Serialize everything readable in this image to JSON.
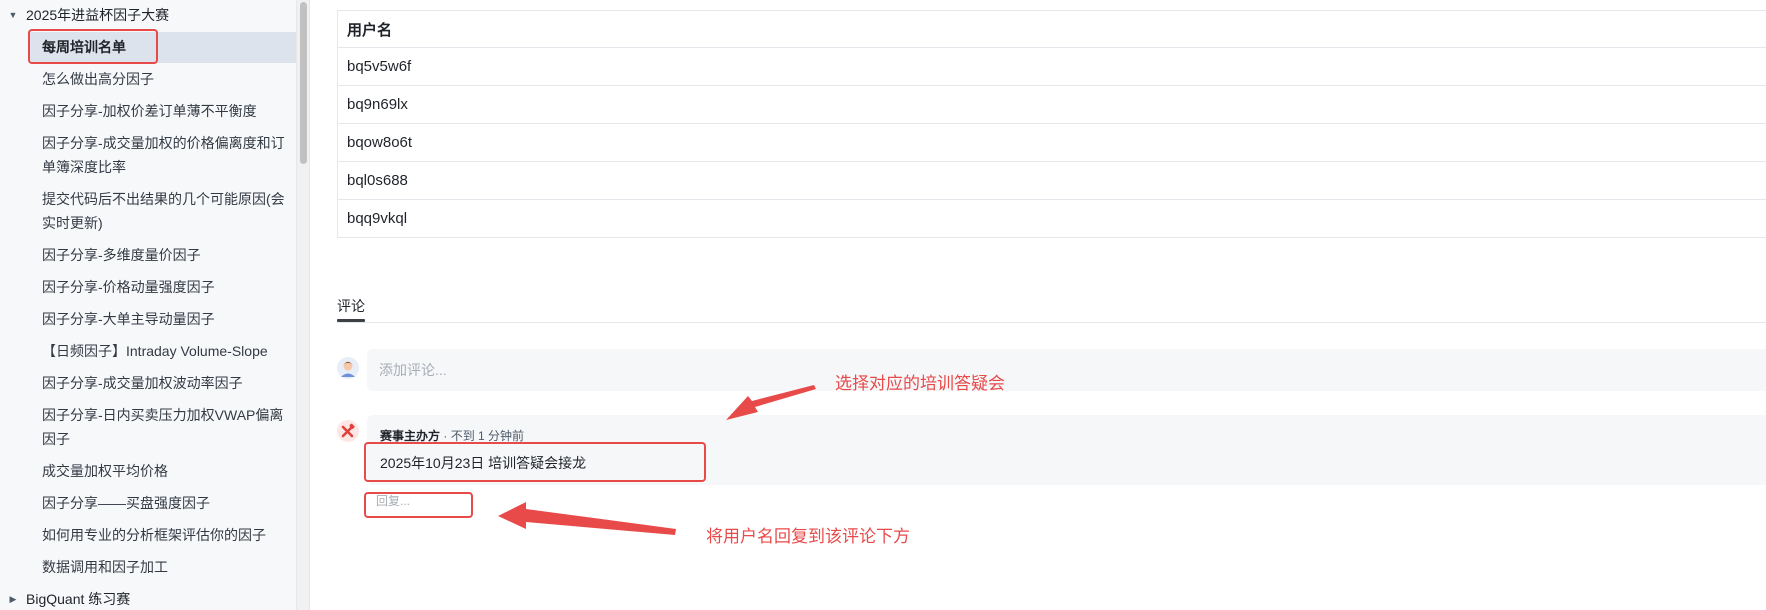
{
  "sidebar": {
    "group_open": "2025年进益杯因子大赛",
    "active_item": "每周培训名单",
    "items": [
      "怎么做出高分因子",
      "因子分享-加权价差订单薄不平衡度",
      "因子分享-成交量加权的价格偏离度和订单簿深度比率",
      "提交代码后不出结果的几个可能原因(会实时更新)",
      "因子分享-多维度量价因子",
      "因子分享-价格动量强度因子",
      "因子分享-大单主导动量因子",
      "【日频因子】Intraday Volume-Slope",
      "因子分享-成交量加权波动率因子",
      "因子分享-日内买卖压力加权VWAP偏离因子",
      "成交量加权平均价格",
      "因子分享——买盘强度因子",
      "如何用专业的分析框架评估你的因子",
      "数据调用和因子加工"
    ],
    "group_closed": "BigQuant 练习赛"
  },
  "table": {
    "header": "用户名",
    "rows": [
      "bq5v5w6f",
      "bq9n69lx",
      "bqow8o6t",
      "bql0s688",
      "bqq9vkql"
    ]
  },
  "comments": {
    "tab_label": "评论",
    "input_placeholder": "添加评论...",
    "author": "赛事主办方",
    "time": "· 不到 1 分钟前",
    "text": "2025年10月23日 培训答疑会接龙",
    "reply_placeholder": "回复..."
  },
  "annotations": {
    "note_select": "选择对应的培训答疑会",
    "note_reply": "将用户名回复到该评论下方",
    "color": "#e84a4a"
  },
  "icons": {
    "caret_open": "caret-down-icon",
    "caret_closed": "caret-right-icon",
    "user_avatar": "user-avatar-icon",
    "host_avatar": "tools-icon"
  }
}
